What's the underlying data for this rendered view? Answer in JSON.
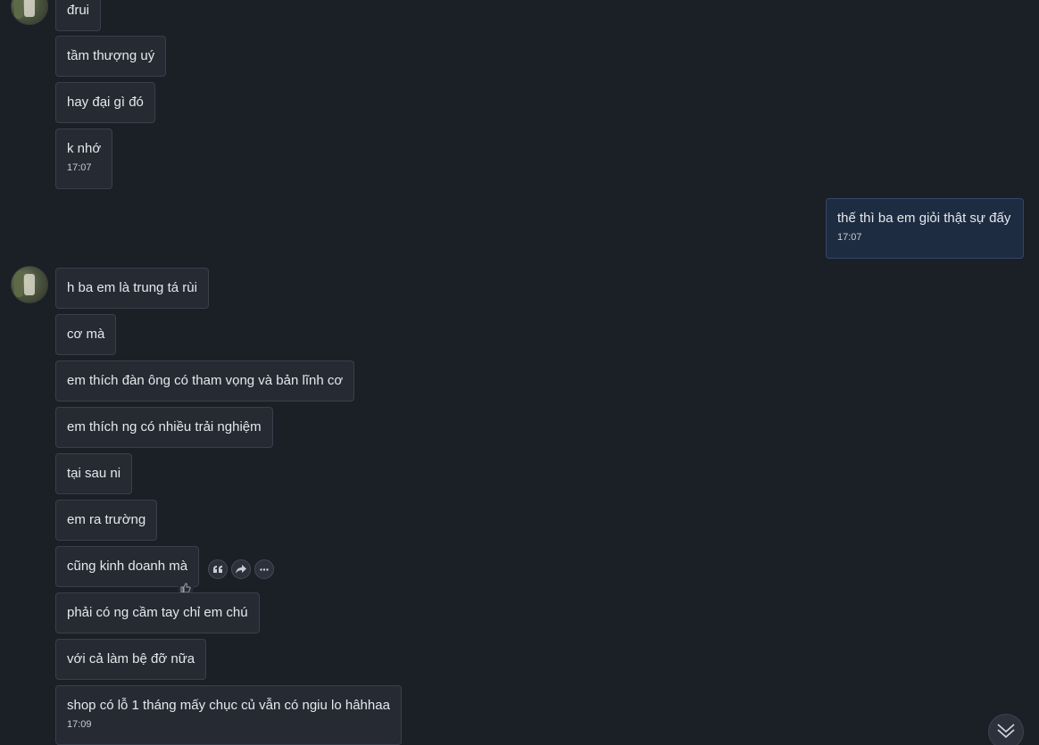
{
  "messages": {
    "m1": {
      "text": "đrui"
    },
    "m2": {
      "text": "tầm thượng uý"
    },
    "m3": {
      "text": "hay đại gì đó"
    },
    "m4": {
      "text": "k nhớ",
      "time": "17:07"
    },
    "m5": {
      "text": "thế thì ba em giỏi thật sự đấy",
      "time": "17:07"
    },
    "m6": {
      "text": "h ba em là trung tá rùi"
    },
    "m7": {
      "text": "cơ mà"
    },
    "m8": {
      "text": "em thích đàn ông có tham vọng và bản lĩnh cơ"
    },
    "m9": {
      "text": "em thích ng có nhiều trải nghiệm"
    },
    "m10": {
      "text": "tại sau ni"
    },
    "m11": {
      "text": "em ra trường"
    },
    "m12": {
      "text": "cũng kinh doanh mà"
    },
    "m13": {
      "text": "phải có ng cầm tay chỉ em chú"
    },
    "m14": {
      "text": "với cả làm bệ đỡ nữa"
    },
    "m15": {
      "text": "shop có lỗ 1 tháng mấy chục củ vẫn có ngiu lo hâhhaa",
      "time": "17:09"
    }
  },
  "colors": {
    "background": "#1b1f26",
    "incoming_bubble": "#252a33",
    "outgoing_bubble": "#1e2c42",
    "text": "#e6e8ec"
  },
  "icons": {
    "reply": "quote-icon",
    "forward": "forward-arrow-icon",
    "more": "more-horizontal-icon",
    "react": "thumbs-up-icon",
    "scroll": "double-chevron-down-icon"
  }
}
